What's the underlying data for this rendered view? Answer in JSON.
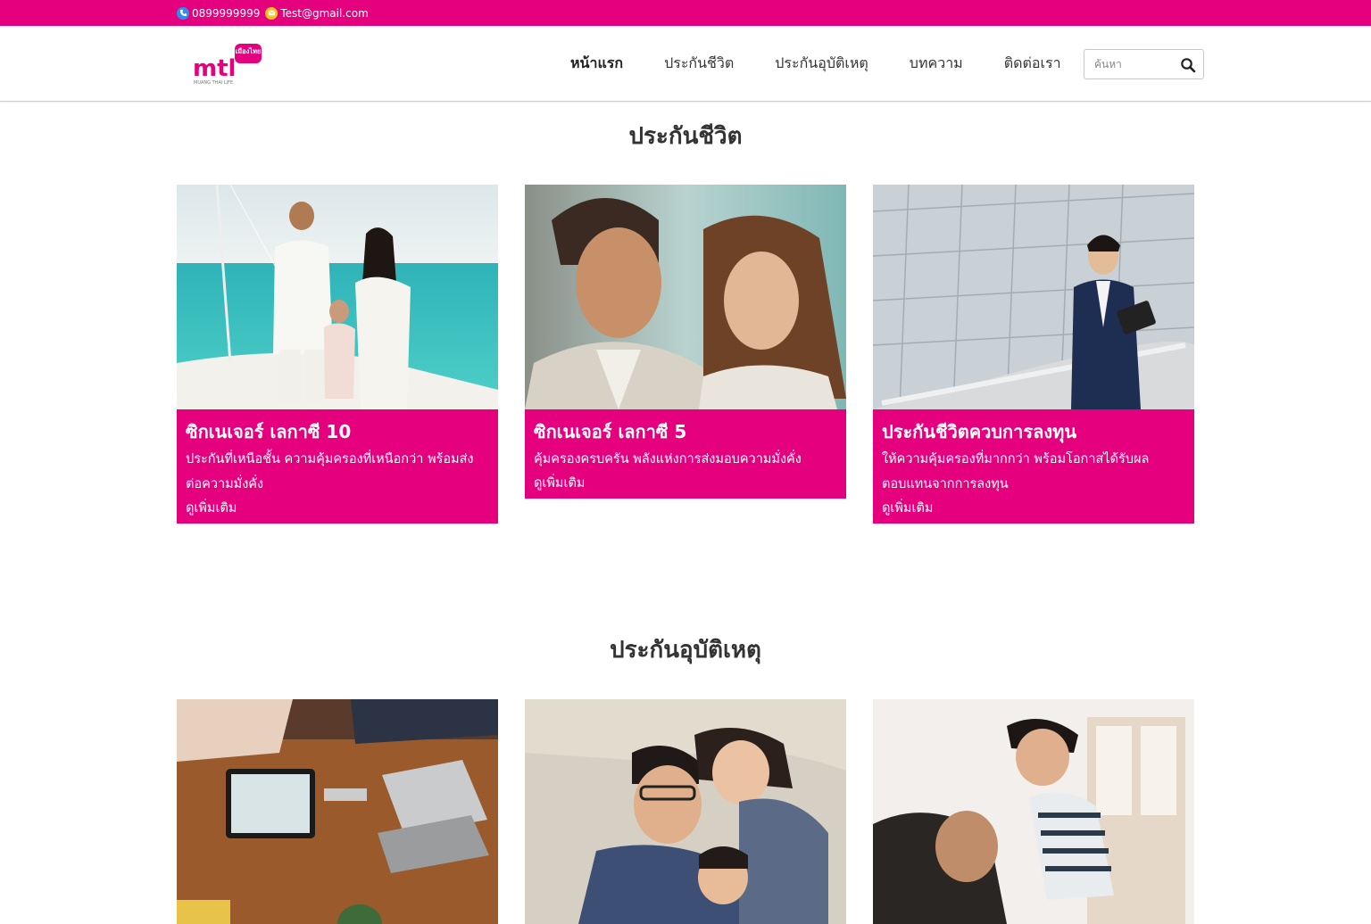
{
  "topbar": {
    "phone": "0899999999",
    "email": "Test@gmail.com",
    "phone_icon": "phone-icon",
    "email_icon": "mail-icon"
  },
  "header": {
    "logo_text": "mtl",
    "logo_badge": "เมืองไทย",
    "logo_sub": "MUANG THAI LIFE",
    "nav": [
      {
        "label": "หน้าแรก",
        "active": true
      },
      {
        "label": "ประกันชีวิต",
        "active": false
      },
      {
        "label": "ประกันอุบัติเหตุ",
        "active": false
      },
      {
        "label": "บทความ",
        "active": false
      },
      {
        "label": "ติดต่อเรา",
        "active": false
      }
    ],
    "search": {
      "placeholder": "ค้นหา",
      "icon": "search-icon"
    }
  },
  "sections": [
    {
      "title": "ประกันชีวิต",
      "cards": [
        {
          "title": "ซิกเนเจอร์ เลกาซี 10",
          "desc": "ประกันที่เหนือชั้น ความคุ้มครองที่เหนือกว่า พร้อมส่งต่อความมั่งคั่ง",
          "more": "ดูเพิ่มเติม"
        },
        {
          "title": "ซิกเนเจอร์ เลกาซี 5",
          "desc": "คุ้มครองครบครัน พลังแห่งการส่งมอบความมั่งคั่ง",
          "more": "ดูเพิ่มเติม"
        },
        {
          "title": "ประกันชีวิตควบการลงทุน",
          "desc": "ให้ความคุ้มครองที่มากกว่า พร้อมโอกาสได้รับผลตอบแทนจากการลงทุน",
          "more": "ดูเพิ่มเติม"
        }
      ]
    },
    {
      "title": "ประกันอุบัติเหตุ",
      "cards": [
        {},
        {},
        {}
      ]
    }
  ],
  "colors": {
    "brand": "#e5007e",
    "text": "#333333"
  }
}
